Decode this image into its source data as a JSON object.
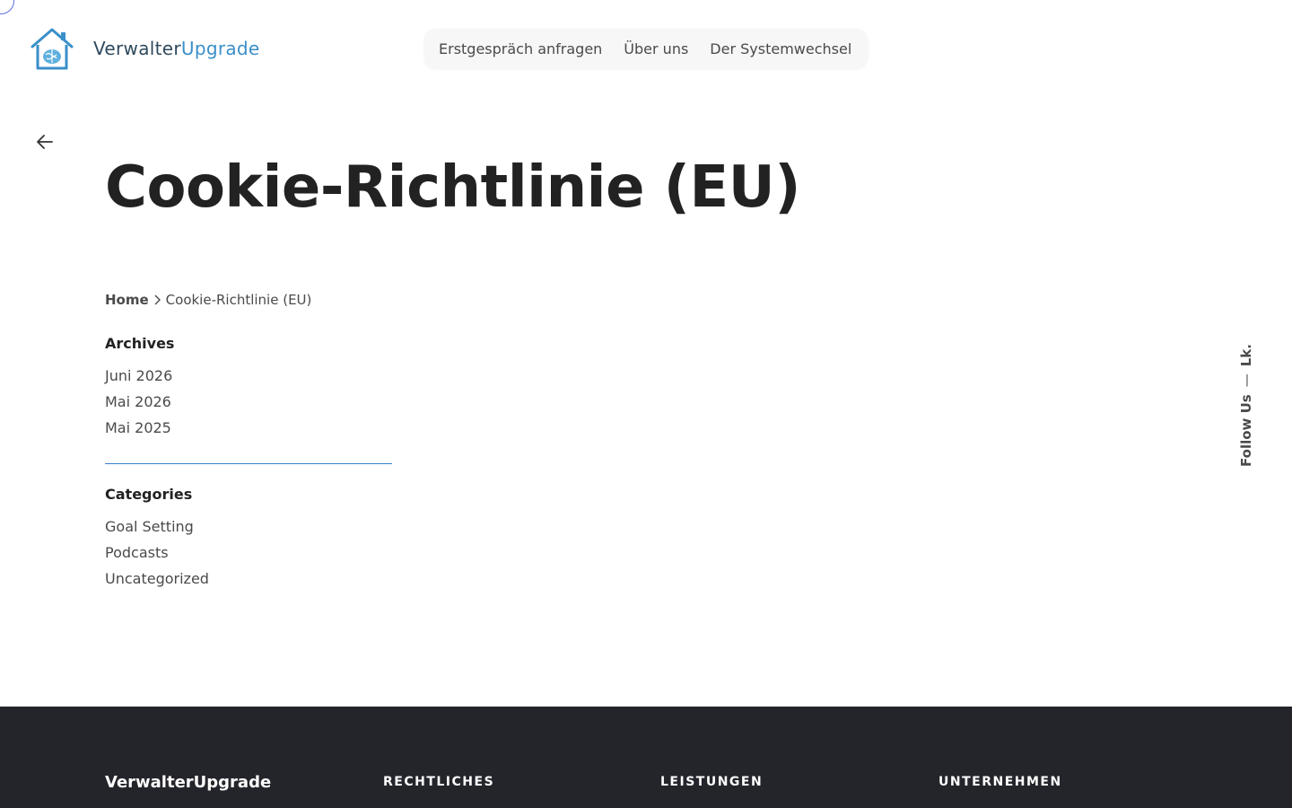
{
  "header": {
    "logo": {
      "word1": "Verwalter",
      "word2": "Upgrade"
    },
    "nav": [
      {
        "label": "Erstgespräch anfragen"
      },
      {
        "label": "Über uns"
      },
      {
        "label": "Der Systemwechsel"
      }
    ]
  },
  "page": {
    "title": "Cookie-Richtlinie (EU)"
  },
  "breadcrumb": {
    "home": "Home",
    "current": "Cookie-Richtlinie (EU)"
  },
  "archives": {
    "title": "Archives",
    "items": [
      "Juni 2026",
      "Mai 2026",
      "Mai 2025"
    ]
  },
  "categories": {
    "title": "Categories",
    "items": [
      "Goal Setting",
      "Podcasts",
      "Uncategorized"
    ]
  },
  "follow": {
    "label": "Follow Us",
    "dash": "—",
    "link": "Lk."
  },
  "footer": {
    "brand": "VerwalterUpgrade",
    "columns": [
      "RECHTLICHES",
      "LEISTUNGEN",
      "UNTERNEHMEN"
    ]
  },
  "colors": {
    "footer_bg": "#24252b",
    "brand_blue": "#3a8fc9",
    "brand_dark": "#2f4a5e",
    "divider": "#3a7fc3"
  }
}
